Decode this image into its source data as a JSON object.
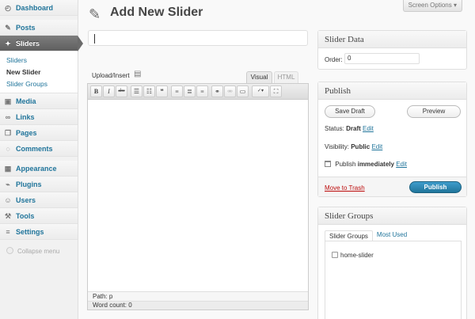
{
  "sidebar": {
    "dashboard": "Dashboard",
    "posts": "Posts",
    "sliders": "Sliders",
    "submenu": [
      "Sliders",
      "New Slider",
      "Slider Groups"
    ],
    "media": "Media",
    "links": "Links",
    "pages": "Pages",
    "comments": "Comments",
    "appearance": "Appearance",
    "plugins": "Plugins",
    "users": "Users",
    "tools": "Tools",
    "settings": "Settings",
    "collapse": "Collapse menu"
  },
  "header": {
    "title": "Add New Slider",
    "screen_options": "Screen Options ▾"
  },
  "editor": {
    "title_value": "",
    "upload_insert": "Upload/Insert",
    "tab_visual": "Visual",
    "tab_html": "HTML",
    "path_label": "Path:",
    "path_value": "p",
    "word_count": "Word count: 0"
  },
  "slider_data": {
    "heading": "Slider Data",
    "order_label": "Order:",
    "order_value": "0"
  },
  "publish": {
    "heading": "Publish",
    "save_draft": "Save Draft",
    "preview": "Preview",
    "status_label": "Status:",
    "status_value": "Draft",
    "visibility_label": "Visibility:",
    "visibility_value": "Public",
    "schedule_label": "Publish",
    "schedule_value": "immediately",
    "edit": "Edit",
    "move_to_trash": "Move to Trash",
    "publish_button": "Publish"
  },
  "slider_groups": {
    "heading": "Slider Groups",
    "tab_all": "Slider Groups",
    "tab_used": "Most Used",
    "items": [
      "home-slider"
    ]
  },
  "colors": {
    "link": "#21759b",
    "active_menu": "#6b6b6b",
    "publish_button": "#21759b",
    "trash": "#bc0b0b"
  }
}
